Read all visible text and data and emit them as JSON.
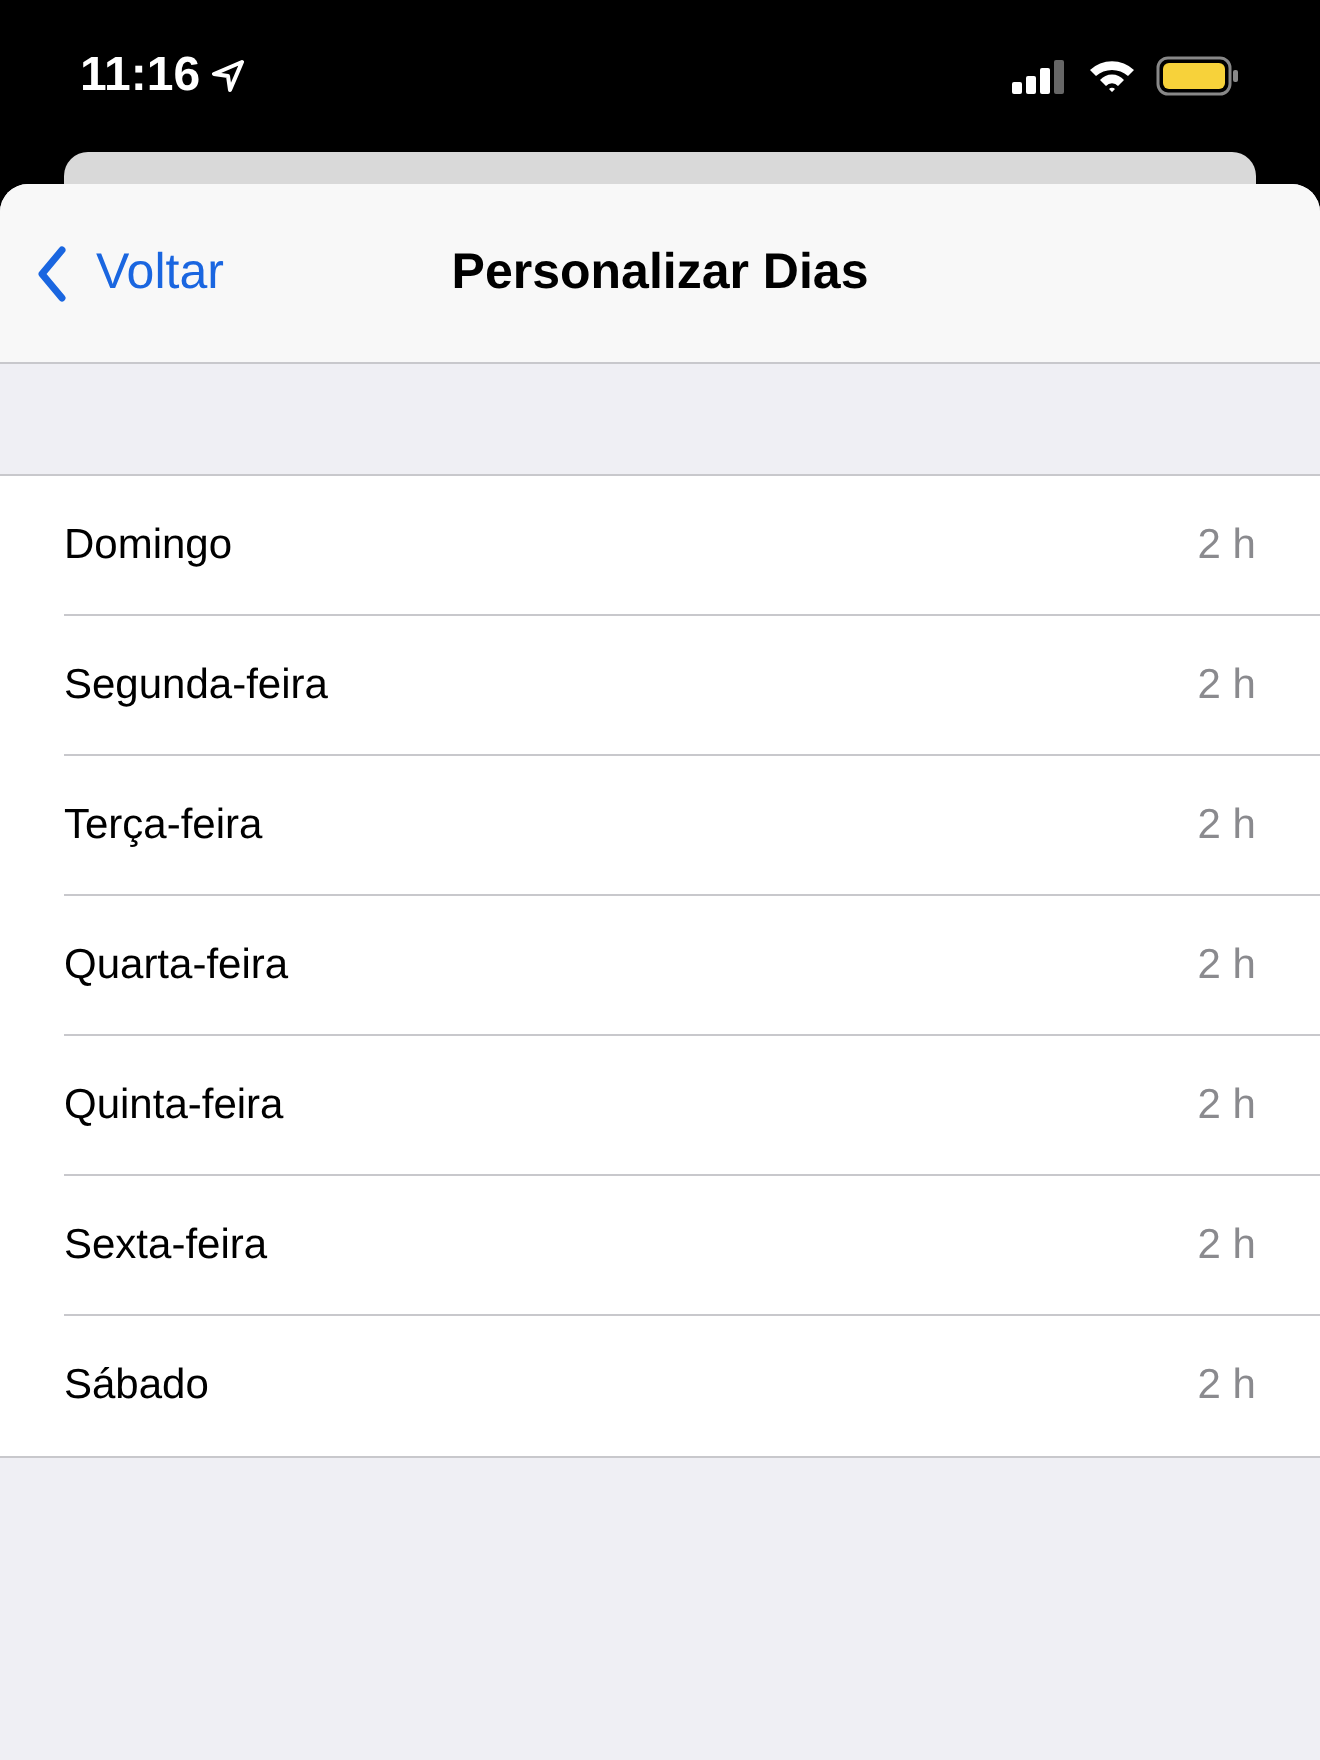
{
  "status_bar": {
    "time": "11:16"
  },
  "nav": {
    "back": "Voltar",
    "title": "Personalizar Dias"
  },
  "days": [
    {
      "name": "Domingo",
      "value": "2 h"
    },
    {
      "name": "Segunda-feira",
      "value": "2 h"
    },
    {
      "name": "Terça-feira",
      "value": "2 h"
    },
    {
      "name": "Quarta-feira",
      "value": "2 h"
    },
    {
      "name": "Quinta-feira",
      "value": "2 h"
    },
    {
      "name": "Sexta-feira",
      "value": "2 h"
    },
    {
      "name": "Sábado",
      "value": "2 h"
    }
  ]
}
